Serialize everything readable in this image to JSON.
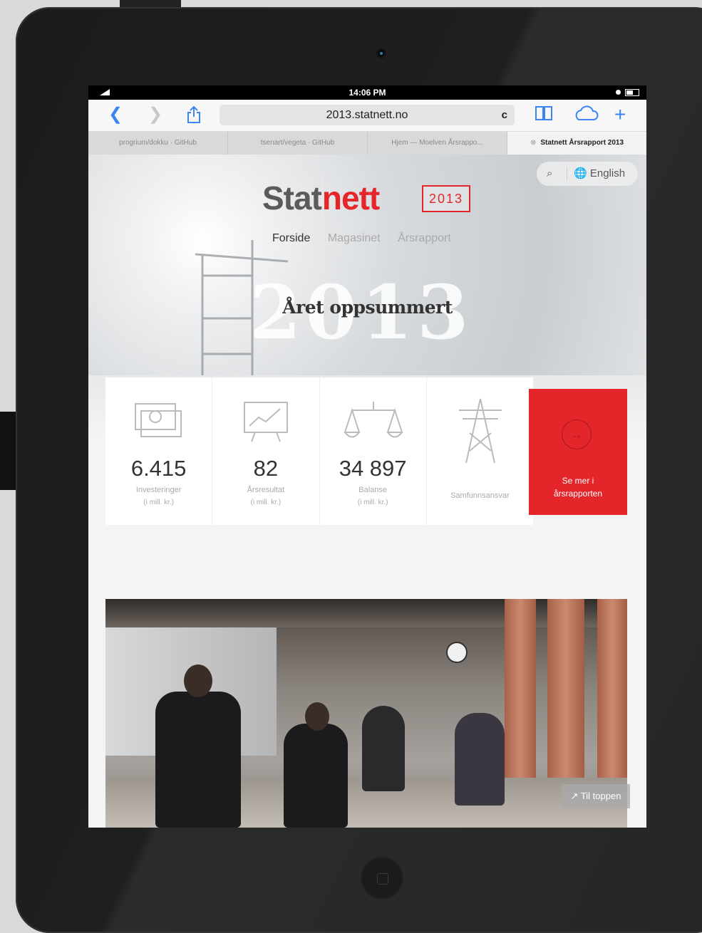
{
  "status_bar": {
    "time": "14:06 PM"
  },
  "browser": {
    "url": "2013.statnett.no",
    "reload_icon": "c",
    "tabs": [
      {
        "label": "progrium/dokku · GitHub"
      },
      {
        "label": "tsenart/vegeta · GitHub"
      },
      {
        "label": "Hjem — Moelven Årsrappo..."
      },
      {
        "label": "Statnett Årsrapport 2013",
        "active": true
      }
    ]
  },
  "site": {
    "logo_part1": "Stat",
    "logo_part2": "nett",
    "year_badge": "2013",
    "search_icon": "⌕",
    "language": "English",
    "nav": [
      {
        "label": "Forside",
        "current": true
      },
      {
        "label": "Magasinet"
      },
      {
        "label": "Årsrapport"
      }
    ],
    "hero_year": "2013",
    "hero_title": "Året oppsummert",
    "accent_color": "#e4262a",
    "stats": [
      {
        "value": "6.415",
        "label": "Investeringer",
        "sub": "(i mill. kr.)",
        "icon": "money-icon"
      },
      {
        "value": "82",
        "label": "Årsresultat",
        "sub": "(i mill. kr.)",
        "icon": "chart-icon"
      },
      {
        "value": "34 897",
        "label": "Balanse",
        "sub": "(i mill. kr.)",
        "icon": "scale-icon"
      },
      {
        "value": "",
        "label": "Samfunnsansvar",
        "sub": "",
        "icon": "pylon-icon"
      }
    ],
    "cta_line1": "Se mer i",
    "cta_line2": "årsrapporten",
    "to_top": "Til toppen"
  }
}
